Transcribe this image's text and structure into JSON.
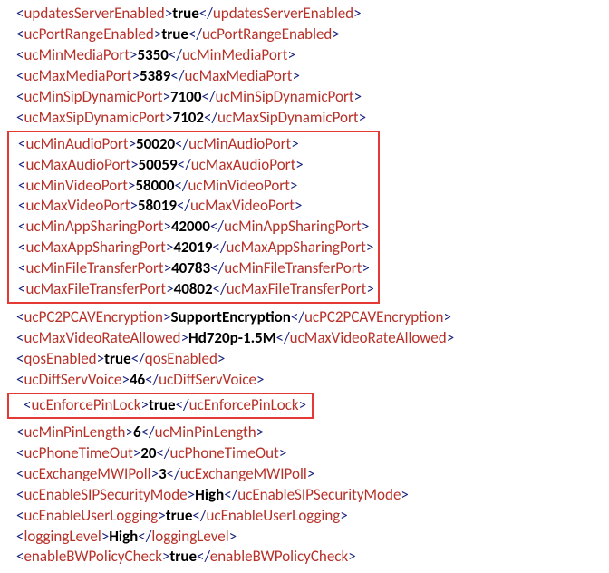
{
  "linesTop": [
    {
      "tag": "updatesServerEnabled",
      "value": "true"
    },
    {
      "tag": "ucPortRangeEnabled",
      "value": "true"
    },
    {
      "tag": "ucMinMediaPort",
      "value": "5350"
    },
    {
      "tag": "ucMaxMediaPort",
      "value": "5389"
    },
    {
      "tag": "ucMinSipDynamicPort",
      "value": "7100"
    },
    {
      "tag": "ucMaxSipDynamicPort",
      "value": "7102"
    }
  ],
  "linesBox1": [
    {
      "tag": "ucMinAudioPort",
      "value": "50020"
    },
    {
      "tag": "ucMaxAudioPort",
      "value": "50059"
    },
    {
      "tag": "ucMinVideoPort",
      "value": "58000"
    },
    {
      "tag": "ucMaxVideoPort",
      "value": "58019"
    },
    {
      "tag": "ucMinAppSharingPort",
      "value": "42000"
    },
    {
      "tag": "ucMaxAppSharingPort",
      "value": "42019"
    },
    {
      "tag": "ucMinFileTransferPort",
      "value": "40783"
    },
    {
      "tag": "ucMaxFileTransferPort",
      "value": "40802"
    }
  ],
  "linesMid": [
    {
      "tag": "ucPC2PCAVEncryption",
      "value": "SupportEncryption"
    },
    {
      "tag": "ucMaxVideoRateAllowed",
      "value": "Hd720p-1.5M"
    },
    {
      "tag": "qosEnabled",
      "value": "true"
    },
    {
      "tag": "ucDiffServVoice",
      "value": "46"
    }
  ],
  "lineBox2": {
    "tag": "ucEnforcePinLock",
    "value": "true"
  },
  "linesBottom": [
    {
      "tag": "ucMinPinLength",
      "value": "6"
    },
    {
      "tag": "ucPhoneTimeOut",
      "value": "20"
    },
    {
      "tag": "ucExchangeMWIPoll",
      "value": "3"
    },
    {
      "tag": "ucEnableSIPSecurityMode",
      "value": "High"
    },
    {
      "tag": "ucEnableUserLogging",
      "value": "true"
    },
    {
      "tag": "loggingLevel",
      "value": "High"
    },
    {
      "tag": "enableBWPolicyCheck",
      "value": "true"
    }
  ]
}
